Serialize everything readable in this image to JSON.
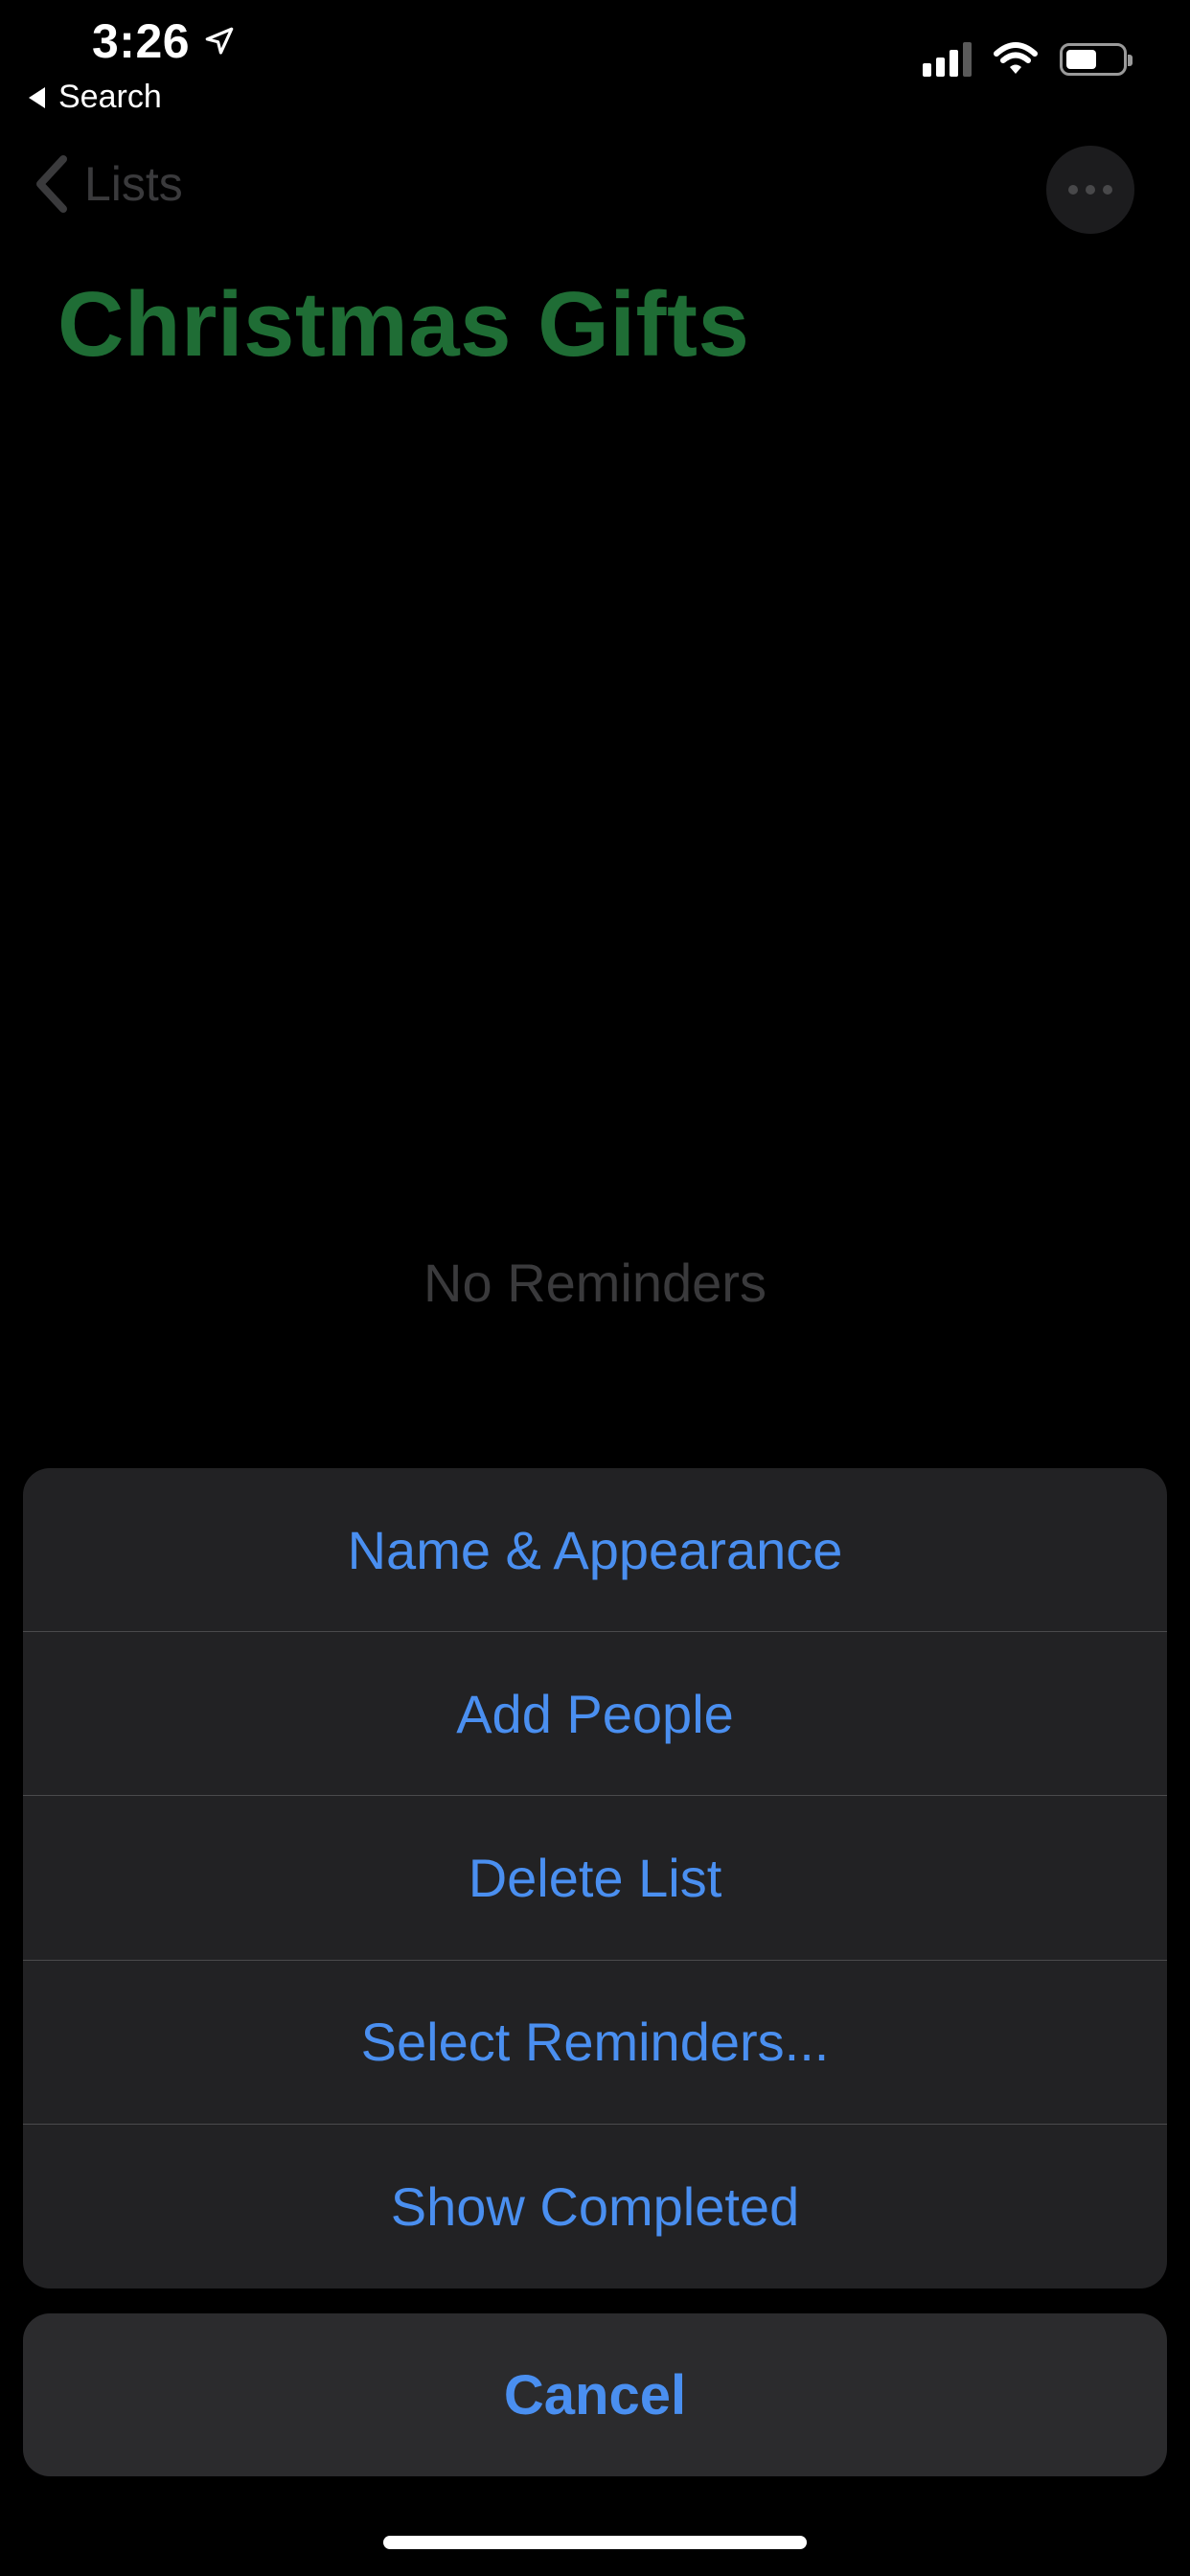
{
  "status_bar": {
    "time": "3:26",
    "back_app_label": "Search",
    "signal_bars_active": 3,
    "signal_bars_total": 4,
    "battery_level": 0.55
  },
  "nav": {
    "back_label": "Lists",
    "more_icon": "ellipsis-icon"
  },
  "list": {
    "title": "Christmas Gifts",
    "title_color": "#1f6d35",
    "empty_text": "No Reminders"
  },
  "action_sheet": {
    "items": [
      {
        "label": "Name & Appearance"
      },
      {
        "label": "Add People"
      },
      {
        "label": "Delete List"
      },
      {
        "label": "Select Reminders..."
      },
      {
        "label": "Show Completed"
      }
    ],
    "cancel_label": "Cancel",
    "accent_color": "#4a8ff0"
  }
}
